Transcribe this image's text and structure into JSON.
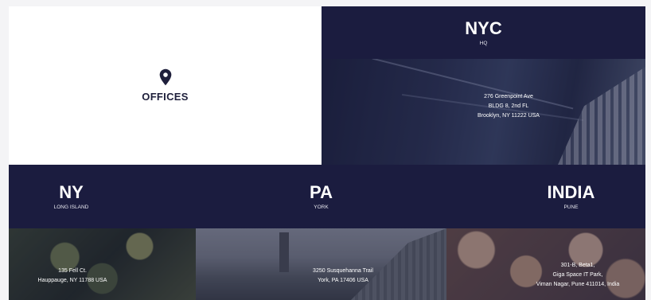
{
  "offices_card": {
    "title": "OFFICES",
    "icon": "map-pin-icon"
  },
  "nyc": {
    "name": "NYC",
    "subtitle": "HQ",
    "address": [
      "276 Greenpoint Ave",
      "BLDG 8, 2nd FL",
      "Brooklyn, NY 11222 USA"
    ]
  },
  "ny": {
    "name": "NY",
    "subtitle": "LONG ISLAND",
    "address": [
      "135 Fell Ct.",
      "Hauppauge, NY 11788 USA"
    ]
  },
  "pa": {
    "name": "PA",
    "subtitle": "YORK",
    "address": [
      "3250 Susquehanna Trail",
      "York, PA 17406 USA"
    ]
  },
  "india": {
    "name": "INDIA",
    "subtitle": "PUNE",
    "address": [
      "301-B, Beta1,",
      "Giga Space IT Park,",
      "Viman Nagar, Pune 411014, India"
    ]
  },
  "colors": {
    "navy": "#1b1c3f",
    "white": "#ffffff",
    "page_bg": "#f4f4f6"
  }
}
